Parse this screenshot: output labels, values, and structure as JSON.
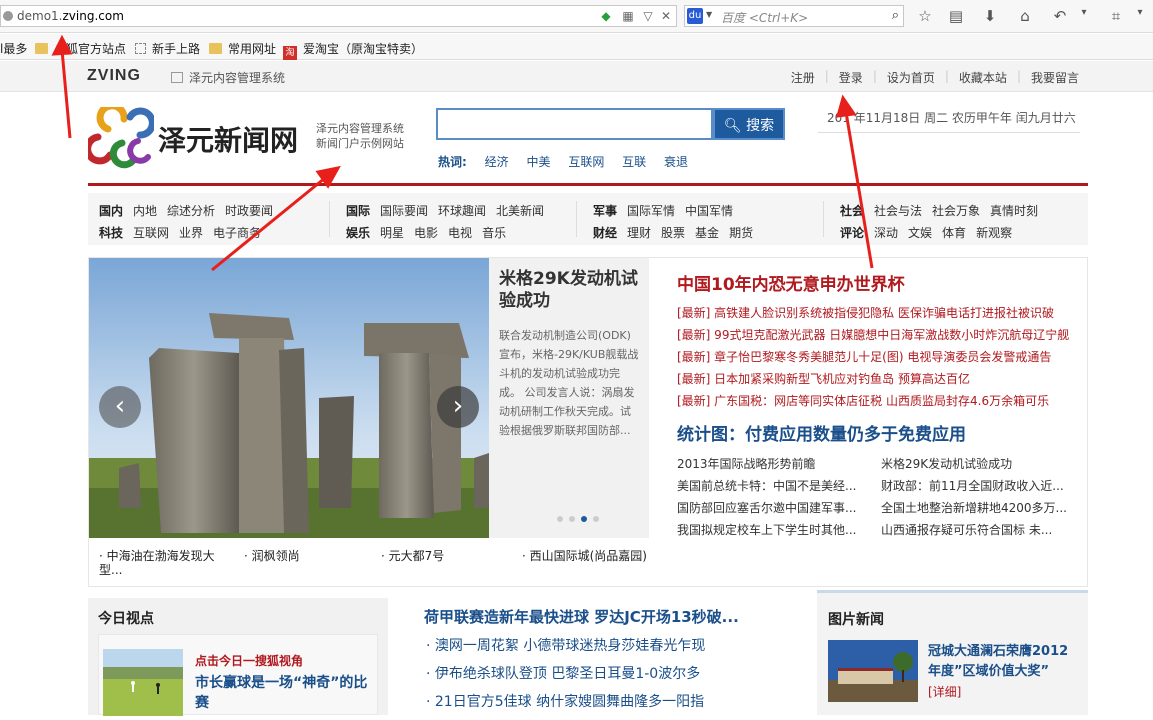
{
  "browser": {
    "url_prefix": "demo1.",
    "url_domain": "zving.com",
    "search_placeholder": "百度 <Ctrl+K>"
  },
  "bookmarks": [
    "l最多",
    "火狐官方站点",
    "新手上路",
    "常用网址",
    "爱淘宝（原淘宝特卖）"
  ],
  "topbar": {
    "logo": "ZVING",
    "system": "泽元内容管理系统",
    "links": [
      "注册",
      "登录",
      "设为首页",
      "收藏本站",
      "我要留言"
    ]
  },
  "header": {
    "site_name": "泽元新闻网",
    "sub1": "泽元内容管理系统",
    "sub2": "新闻门户示例网站",
    "search_button": "搜索",
    "hot_label": "热词:",
    "hot_words": [
      "经济",
      "中美",
      "互联网",
      "互联",
      "衰退"
    ],
    "date": "201  年11月18日  周二  农历甲午年  闰九月廿六"
  },
  "channels": {
    "g1": {
      "r1": [
        "国内",
        "内地",
        "综述分析",
        "时政要闻"
      ],
      "r2": [
        "科技",
        "互联网",
        "业界",
        "电子商务"
      ]
    },
    "g2": {
      "r1": [
        "国际",
        "国际要闻",
        "环球趣闻",
        "北美新闻"
      ],
      "r2": [
        "娱乐",
        "明星",
        "电影",
        "电视",
        "音乐"
      ]
    },
    "g3": {
      "r1": [
        "军事",
        "国际军情",
        "中国军情"
      ],
      "r2": [
        "财经",
        "理财",
        "股票",
        "基金",
        "期货"
      ]
    },
    "g4": {
      "r1": [
        "社会",
        "社会与法",
        "社会万象",
        "真情时刻"
      ],
      "r2": [
        "评论",
        "深动",
        "文娱",
        "体育",
        "新观察"
      ]
    }
  },
  "slide": {
    "title": "米格29K发动机试验成功",
    "desc": "联合发动机制造公司(ODK)宣布，米格-29K/KUB舰载战斗机的发动机试验成功完成。 公司发言人说：涡扇发动机研制工作秋天完成。试验根据俄罗斯联邦国防部...",
    "active_index": 2,
    "thumbs": [
      "· 中海油在渤海发现大型...",
      "· 润枫领尚",
      "· 元大都7号",
      "· 西山国际城(尚品嘉园)"
    ]
  },
  "news": {
    "headline": "中国10年内恐无意申办世界杯",
    "latest": [
      "[最新] 高铁建人脸识别系统被指侵犯隐私  医保诈骗电话打进报社被识破",
      "[最新] 99式坦克配激光武器 日媒臆想中日海军激战数小时炸沉航母辽宁舰",
      "[最新] 章子怡巴黎寒冬秀美腿范儿十足(图)  电视导演委员会发警戒通告",
      "[最新] 日本加紧采购新型飞机应对钓鱼岛  预算高达百亿",
      "[最新] 广东国税：网店等同实体店征税  山西质监局封存4.6万余箱可乐"
    ],
    "headline2": "统计图：付费应用数量仍多于免费应用",
    "grid": [
      [
        "2013年国际战略形势前瞻",
        "米格29K发动机试验成功"
      ],
      [
        "美国前总统卡特：中国不是美经...",
        "财政部：前11月全国财政收入近..."
      ],
      [
        "国防部回应塞舌尔邀中国建军事...",
        "全国土地整治新增耕地4200多万..."
      ],
      [
        "我国拟规定校车上下学生时其他...",
        "山西通报存疑可乐符合国标  未..."
      ]
    ]
  },
  "today": {
    "title": "今日视点",
    "red": "点击今日一搜狐视角",
    "headline": "市长赢球是一场“神奇”的比赛"
  },
  "sports": {
    "title": "荷甲联赛造新年最快进球  罗达JC开场13秒破...",
    "items": [
      "· 澳网一周花絮  小德带球迷热身莎娃春光乍现",
      "· 伊布绝杀球队登顶  巴黎圣日耳曼1-0波尔多",
      "· 21日官方5佳球  纳什家嫂圆舞曲隆多一阳指"
    ]
  },
  "photo": {
    "title": "图片新闻",
    "caption": "冠城大通澜石荣膺2012年度”区域价值大奖”",
    "more": "[详细]"
  }
}
